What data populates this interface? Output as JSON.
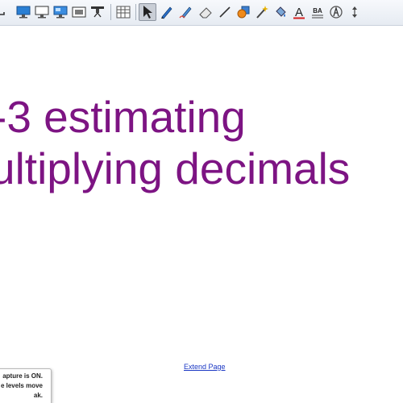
{
  "toolbar": {
    "buttons": [
      {
        "icon": "undo-icon"
      },
      {
        "icon": "monitor-icon"
      },
      {
        "icon": "monitor-screen-icon"
      },
      {
        "icon": "monitor-display-icon"
      },
      {
        "icon": "screen-capture-icon"
      },
      {
        "icon": "projector-icon"
      },
      {
        "icon": "table-icon"
      },
      {
        "icon": "select-arrow-icon",
        "active": true
      },
      {
        "icon": "pen-icon"
      },
      {
        "icon": "creative-pen-icon"
      },
      {
        "icon": "eraser-icon"
      },
      {
        "icon": "line-icon"
      },
      {
        "icon": "shapes-icon"
      },
      {
        "icon": "magic-pen-icon"
      },
      {
        "icon": "fill-icon"
      },
      {
        "icon": "text-icon"
      },
      {
        "icon": "text-format-icon"
      },
      {
        "icon": "properties-icon"
      },
      {
        "icon": "move-toolbar-icon"
      }
    ],
    "text_icon_letter": "A",
    "text_format_label": "BA"
  },
  "page": {
    "title_line_1": "-3 estimating",
    "title_line_2": "ultiplying decimals",
    "extend_link": "Extend Page"
  },
  "notice": {
    "line_1": "apture is ON.",
    "line_2": "e levels move",
    "line_3": "ak."
  },
  "colors": {
    "title_text": "#7d1483",
    "link": "#1a37c4",
    "toolbar_bg": "#e6ebf2"
  }
}
